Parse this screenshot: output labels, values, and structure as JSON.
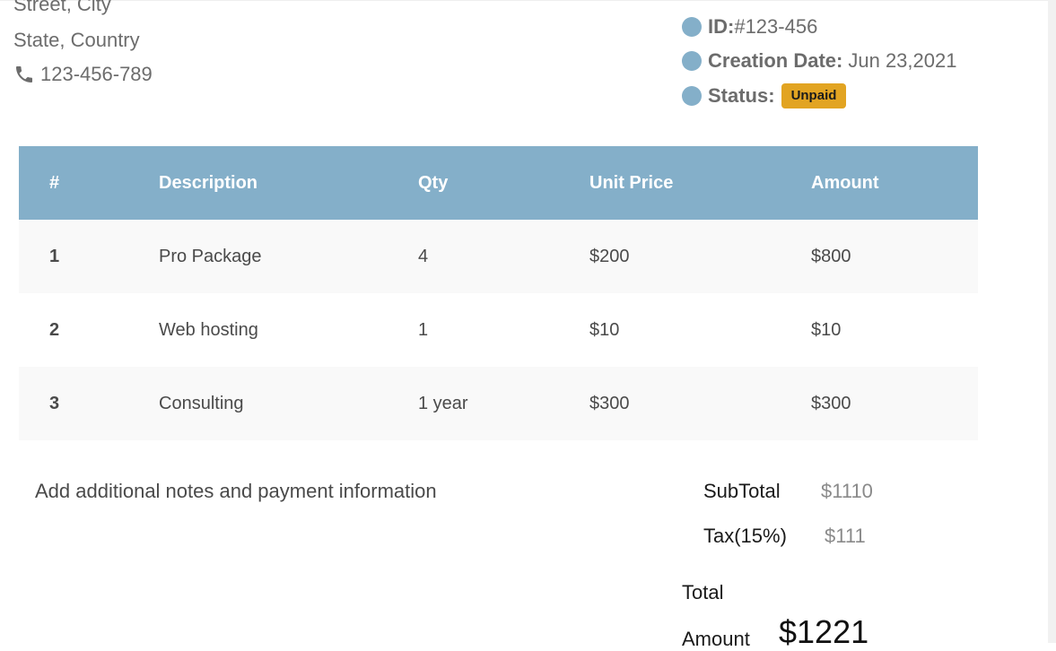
{
  "address": {
    "street_city": "Street, City",
    "state_country": "State, Country",
    "phone": "123-456-789"
  },
  "meta": {
    "id_label": "ID:",
    "id_value": "#123-456",
    "creation_label": "Creation Date:",
    "creation_value": "Jun 23,2021",
    "status_label": "Status:",
    "status_badge": "Unpaid"
  },
  "table": {
    "headers": [
      "#",
      "Description",
      "Qty",
      "Unit Price",
      "Amount"
    ],
    "rows": [
      [
        "1",
        "Pro Package",
        "4",
        "$200",
        "$800"
      ],
      [
        "2",
        "Web hosting",
        "1",
        "$10",
        "$10"
      ],
      [
        "3",
        "Consulting",
        "1 year",
        "$300",
        "$300"
      ]
    ]
  },
  "notes": "Add additional notes and payment information",
  "totals": {
    "subtotal_label": "SubTotal",
    "subtotal_value": "$1110",
    "tax_label": "Tax(15%)",
    "tax_value": "$111",
    "total_label_line1": "Total",
    "total_label_line2": "Amount",
    "total_value": "$1221"
  },
  "colors": {
    "table_header": "#84afc9",
    "status_badge": "#e2a422",
    "meta_dot": "#84afc9"
  },
  "icons": {
    "phone": "phone-icon",
    "meta_bullet": "circle-bullet-icon"
  }
}
